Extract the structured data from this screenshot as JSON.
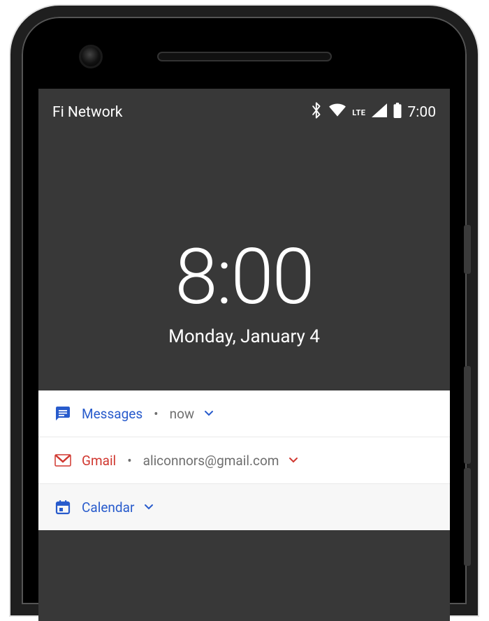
{
  "status_bar": {
    "carrier": "Fi Network",
    "lte_label": "LTE",
    "time": "7:00"
  },
  "lock_screen": {
    "time": "8:00",
    "date": "Monday, January 4"
  },
  "notifications": [
    {
      "app": "Messages",
      "detail": "now",
      "accent": "#285bcc"
    },
    {
      "app": "Gmail",
      "detail": "aliconnors@gmail.com",
      "accent": "#d0372f"
    },
    {
      "app": "Calendar",
      "detail": "",
      "accent": "#285bcc"
    }
  ]
}
